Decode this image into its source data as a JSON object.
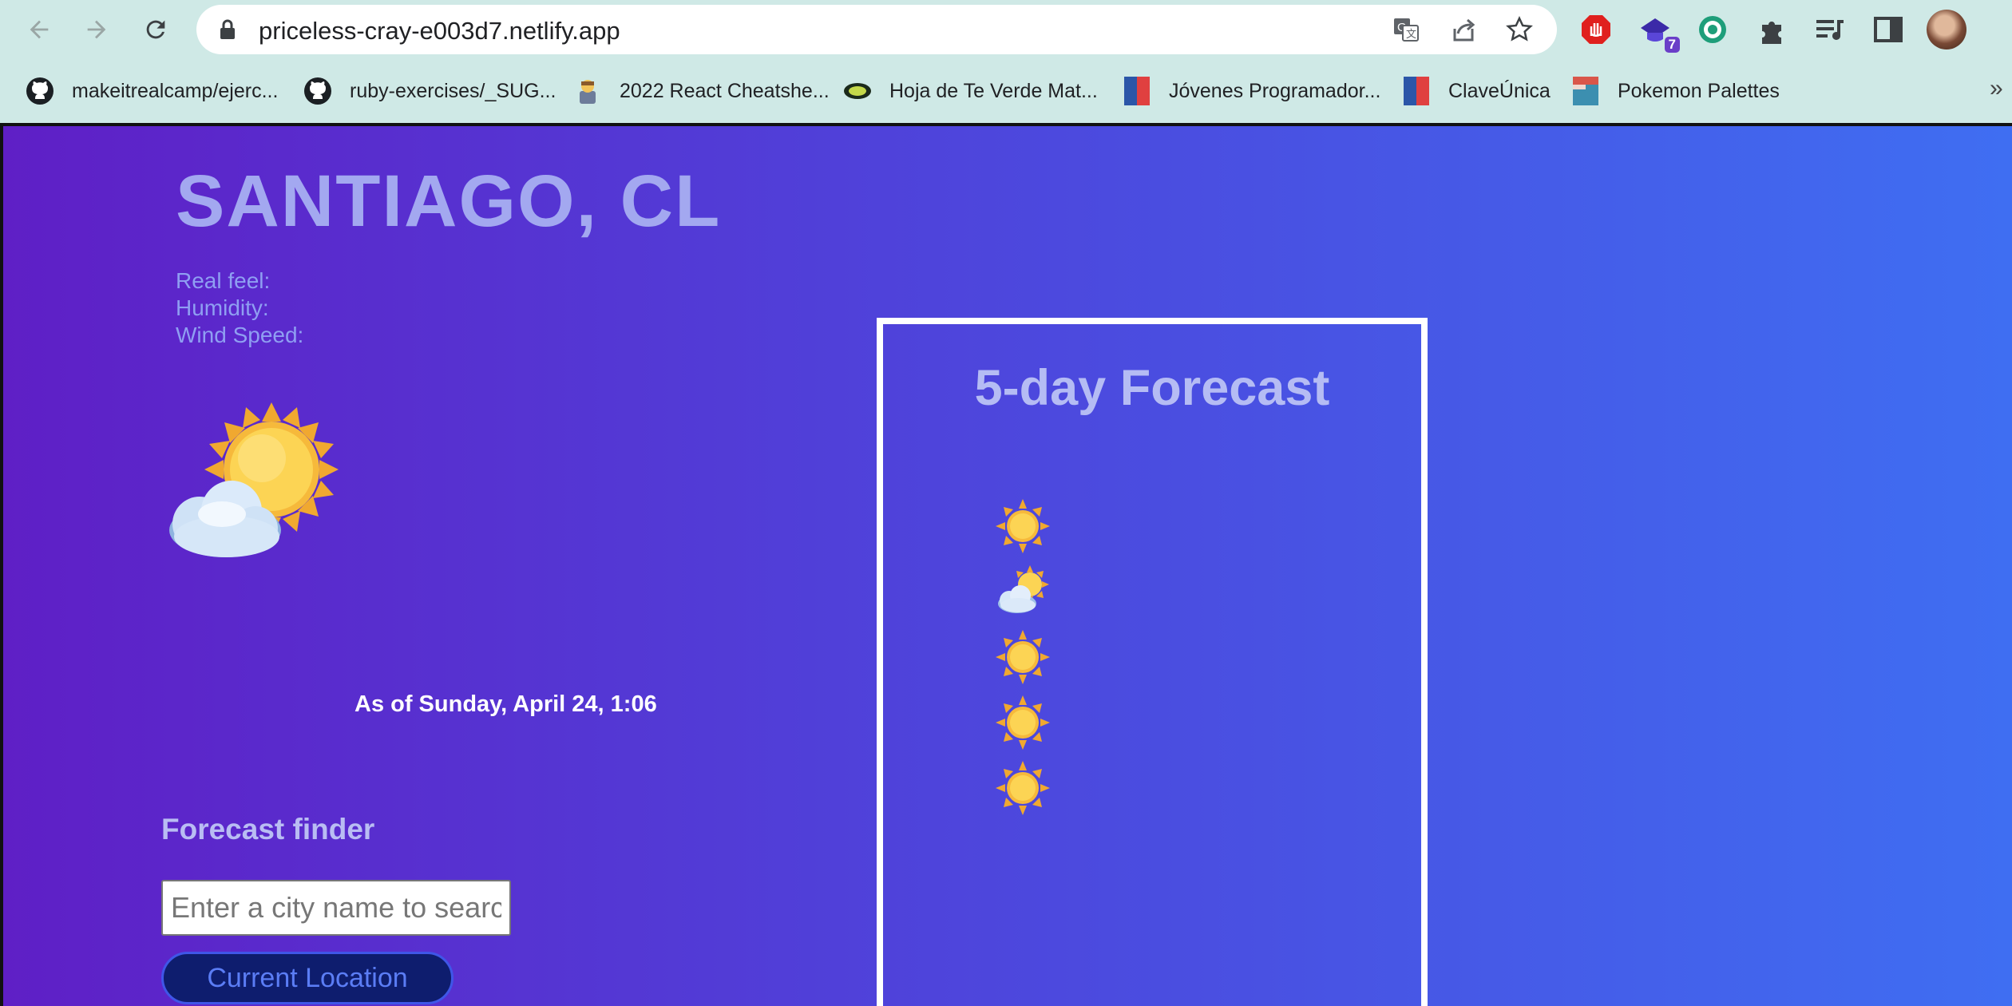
{
  "browser": {
    "url": "priceless-cray-e003d7.netlify.app",
    "extension_badge": "7",
    "bookmarks": [
      {
        "label": "makeitrealcamp/ejerc...",
        "icon": "github-icon"
      },
      {
        "label": "ruby-exercises/_SUG...",
        "icon": "github-icon"
      },
      {
        "label": "2022 React Cheatshe...",
        "icon": "character-icon"
      },
      {
        "label": "Hoja de Te Verde Mat...",
        "icon": "leaf-icon"
      },
      {
        "label": "Jóvenes Programador...",
        "icon": "flag-icon"
      },
      {
        "label": "ClaveÚnica",
        "icon": "flag-icon"
      },
      {
        "label": "Pokemon Palettes",
        "icon": "palette-icon"
      }
    ]
  },
  "weather": {
    "city": "SANTIAGO, CL",
    "real_feel_label": "Real feel:",
    "humidity_label": "Humidity:",
    "wind_speed_label": "Wind Speed:",
    "current_icon": "sun-behind-cloud-icon",
    "as_of": "As of Sunday, April 24, 1:06"
  },
  "finder": {
    "title": "Forecast finder",
    "placeholder": "Enter a city name to search",
    "current_location_label": "Current Location"
  },
  "forecast": {
    "title": "5-day Forecast",
    "days": [
      {
        "icon": "sun-icon"
      },
      {
        "icon": "sun-behind-cloud-icon"
      },
      {
        "icon": "sun-icon"
      },
      {
        "icon": "sun-icon"
      },
      {
        "icon": "sun-icon"
      }
    ]
  },
  "colors": {
    "gradient_start": "#5f1fc6",
    "gradient_end": "#3f6ef2",
    "heading_text": "#a3a8f0",
    "button_bg": "#0e1d6e"
  }
}
